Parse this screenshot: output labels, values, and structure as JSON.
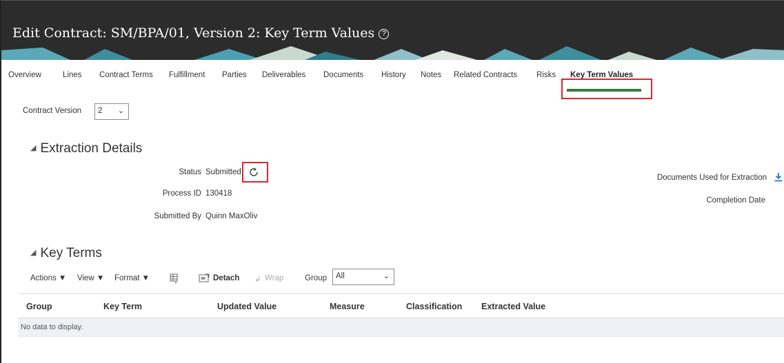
{
  "header": {
    "title": "Edit Contract: SM/BPA/01, Version 2: Key Term Values",
    "help_glyph": "?"
  },
  "tabs": [
    {
      "label": "Overview"
    },
    {
      "label": "Lines"
    },
    {
      "label": "Contract Terms"
    },
    {
      "label": "Fulfillment"
    },
    {
      "label": "Parties"
    },
    {
      "label": "Deliverables"
    },
    {
      "label": "Documents"
    },
    {
      "label": "History"
    },
    {
      "label": "Notes"
    },
    {
      "label": "Related Contracts"
    },
    {
      "label": "Risks"
    },
    {
      "label": "Key Term Values",
      "active": true
    }
  ],
  "contract_version": {
    "label": "Contract Version",
    "value": "2"
  },
  "extraction": {
    "title": "Extraction Details",
    "status_label": "Status",
    "status_value": "Submitted",
    "process_label": "Process ID",
    "process_value": "130418",
    "submitted_label": "Submitted By",
    "submitted_value": "Quinn MaxOliv",
    "docs_label": "Documents Used for Extraction",
    "completion_label": "Completion Date"
  },
  "key_terms": {
    "title": "Key Terms",
    "toolbar": {
      "actions": "Actions",
      "view": "View",
      "format": "Format",
      "detach": "Detach",
      "wrap": "Wrap",
      "group_label": "Group",
      "group_value": "All"
    },
    "columns": [
      "Group",
      "Key Term",
      "Updated Value",
      "Measure",
      "Classification",
      "Extracted Value"
    ],
    "empty_text": "No data to display."
  },
  "icons": {
    "refresh": "refresh-icon",
    "download": "download-icon",
    "freeze": "freeze-columns-icon",
    "detach": "detach-icon",
    "wrap": "wrap-icon",
    "help": "help-icon"
  },
  "colors": {
    "header_bg": "#2c2c2c",
    "active_tab_underline": "#3a7a3c",
    "highlight_red": "#e0232e",
    "download_blue": "#2a74c9"
  }
}
